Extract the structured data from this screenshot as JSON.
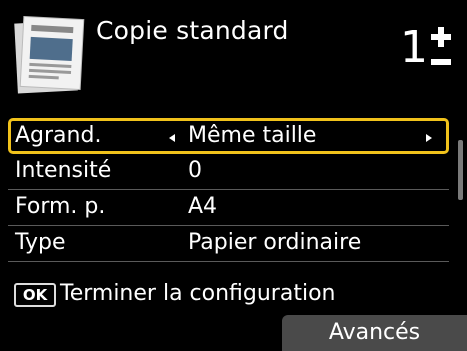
{
  "header": {
    "title": "Copie standard",
    "copies": "1",
    "doc_icon": "standard-copy-document-icon"
  },
  "settings": {
    "rows": [
      {
        "label": "Agrand.",
        "value": "Même taille",
        "selected": true
      },
      {
        "label": "Intensité",
        "value": "0"
      },
      {
        "label": "Form. p.",
        "value": "A4"
      },
      {
        "label": "Type",
        "value": "Papier ordinaire"
      }
    ]
  },
  "footer": {
    "ok_key": "OK",
    "ok_hint": "Terminer la configuration",
    "advanced_label": "Avancés"
  },
  "colors": {
    "background": "#000000",
    "selection_border": "#f1c21b",
    "button_bg": "#4a4a4a"
  }
}
